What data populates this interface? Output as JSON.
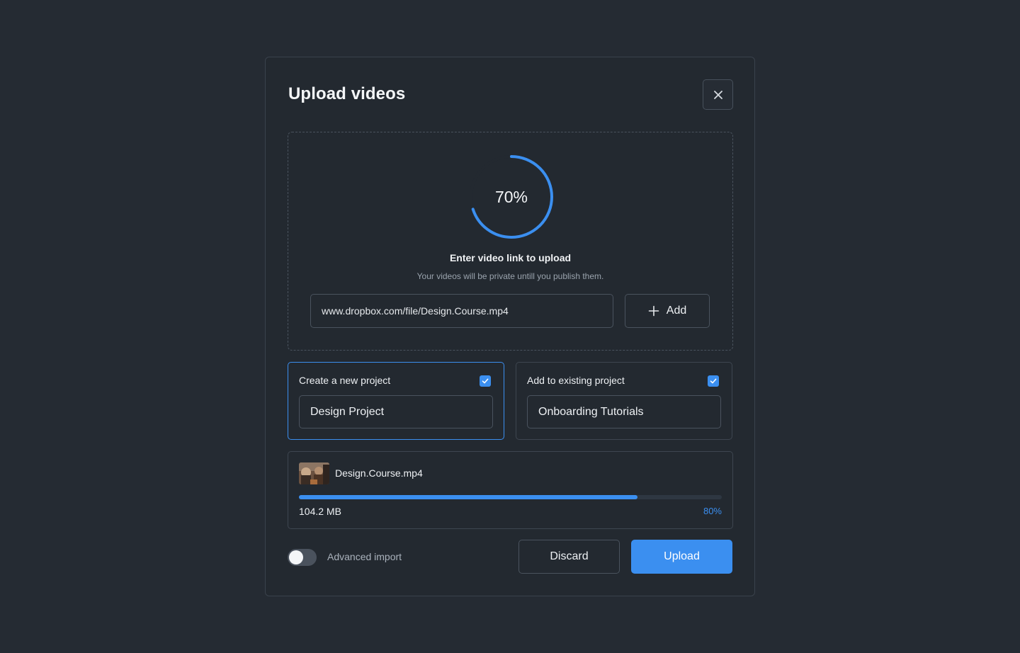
{
  "modal": {
    "title": "Upload videos"
  },
  "upload_progress": {
    "percent": 70,
    "label": "70%"
  },
  "dropzone": {
    "title": "Enter video link to upload",
    "subtitle": "Your videos will be private untill you publish them.",
    "link_value": "www.dropbox.com/file/Design.Course.mp4",
    "add_label": "Add"
  },
  "projects": {
    "new": {
      "label": "Create a new project",
      "value": "Design Project",
      "checked": true
    },
    "existing": {
      "label": "Add to existing project",
      "value": "Onboarding Tutorials",
      "checked": true
    }
  },
  "file": {
    "name": "Design.Course.mp4",
    "size": "104.2 MB",
    "progress": 0.8,
    "progress_label": "80%"
  },
  "footer": {
    "toggle_label": "Advanced import",
    "toggle_on": false,
    "discard_label": "Discard",
    "upload_label": "Upload"
  },
  "colors": {
    "accent": "#3b8ff0",
    "background": "#252b33",
    "panel": "#232930"
  },
  "icons": {
    "close": "close-icon",
    "add": "plus-icon",
    "check": "check-icon"
  }
}
